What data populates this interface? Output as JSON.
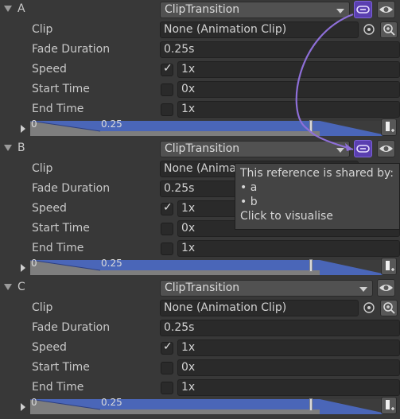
{
  "sections": [
    {
      "label": "A",
      "transition": "ClipTransition",
      "rows": {
        "clip": {
          "label": "Clip",
          "value": "None (Animation Clip)"
        },
        "fade_duration": {
          "label": "Fade Duration",
          "value": "0.25s"
        },
        "speed": {
          "label": "Speed",
          "checked": true,
          "value": "1x"
        },
        "start_time": {
          "label": "Start Time",
          "checked": false,
          "value": "0x"
        },
        "end_time": {
          "label": "End Time",
          "checked": false,
          "value": "1x"
        }
      },
      "timeline": {
        "label0": "0",
        "label1": "0.25"
      }
    },
    {
      "label": "B",
      "transition": "ClipTransition",
      "rows": {
        "clip": {
          "label": "Clip",
          "value": "None (Animation Clip)"
        },
        "fade_duration": {
          "label": "Fade Duration",
          "value": "0.25s"
        },
        "speed": {
          "label": "Speed",
          "checked": true,
          "value": "1x"
        },
        "start_time": {
          "label": "Start Time",
          "checked": false,
          "value": "0x"
        },
        "end_time": {
          "label": "End Time",
          "checked": false,
          "value": "1x"
        }
      },
      "timeline": {
        "label0": "0",
        "label1": "0.25"
      }
    },
    {
      "label": "C",
      "transition": "ClipTransition",
      "rows": {
        "clip": {
          "label": "Clip",
          "value": "None (Animation Clip)"
        },
        "fade_duration": {
          "label": "Fade Duration",
          "value": "0.25s"
        },
        "speed": {
          "label": "Speed",
          "checked": true,
          "value": "1x"
        },
        "start_time": {
          "label": "Start Time",
          "checked": false,
          "value": "0x"
        },
        "end_time": {
          "label": "End Time",
          "checked": false,
          "value": "1x"
        }
      },
      "timeline": {
        "label0": "0",
        "label1": "0.25"
      }
    }
  ],
  "tooltip": {
    "line1": "This reference is shared by:",
    "item1": "• a",
    "item2": "• b",
    "line4": "Click to visualise"
  },
  "icons": {
    "link": "link-icon",
    "eye": "eye-icon",
    "picker": "object-picker-icon",
    "search": "search-icon",
    "add": "add-event-icon"
  },
  "colors": {
    "background": "#383838",
    "accent_purple": "#7c62d6",
    "timeline_blue": "#4a66b8"
  }
}
